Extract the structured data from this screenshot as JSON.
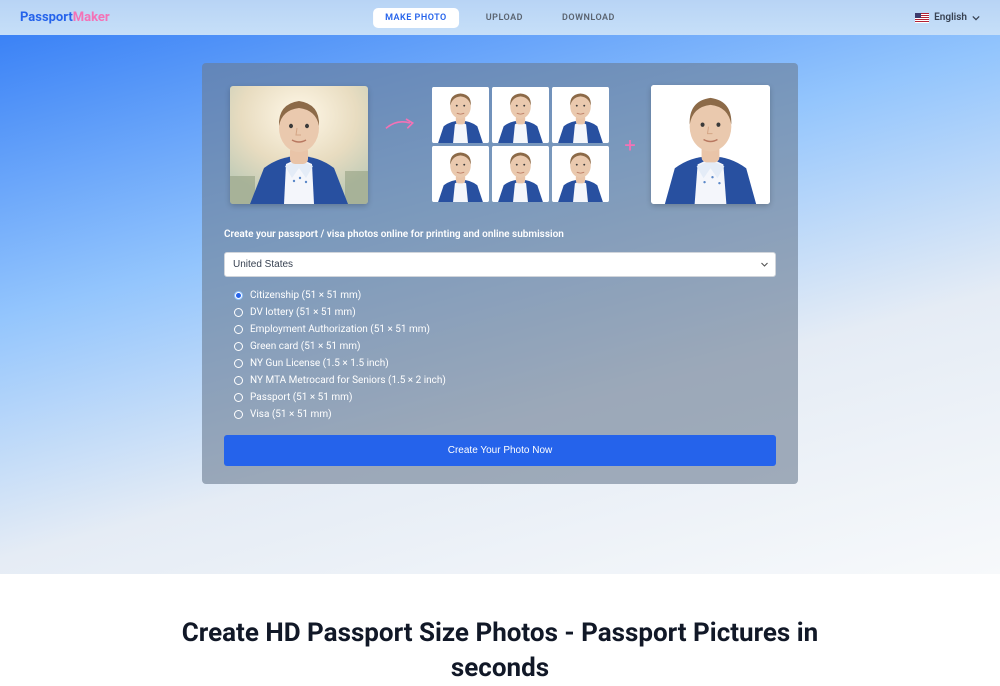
{
  "header": {
    "logo_part1": "Passport",
    "logo_part2": "Maker",
    "nav": [
      {
        "label": "MAKE PHOTO",
        "active": true
      },
      {
        "label": "UPLOAD",
        "active": false
      },
      {
        "label": "DOWNLOAD",
        "active": false
      }
    ],
    "language": "English"
  },
  "hero": {
    "instruction": "Create your passport / visa photos online for printing and online submission",
    "country_selected": "United States",
    "options": [
      {
        "label": "Citizenship (51 × 51 mm)",
        "selected": true
      },
      {
        "label": "DV lottery (51 × 51 mm)",
        "selected": false
      },
      {
        "label": "Employment Authorization (51 × 51 mm)",
        "selected": false
      },
      {
        "label": "Green card (51 × 51 mm)",
        "selected": false
      },
      {
        "label": "NY Gun License (1.5 × 1.5 inch)",
        "selected": false
      },
      {
        "label": "NY MTA Metrocard for Seniors (1.5 × 2 inch)",
        "selected": false
      },
      {
        "label": "Passport (51 × 51 mm)",
        "selected": false
      },
      {
        "label": "Visa (51 × 51 mm)",
        "selected": false
      }
    ],
    "cta_label": "Create Your Photo Now"
  },
  "headline": {
    "line1": "Create HD Passport Size Photos - Passport Pictures in",
    "line2": "seconds"
  }
}
